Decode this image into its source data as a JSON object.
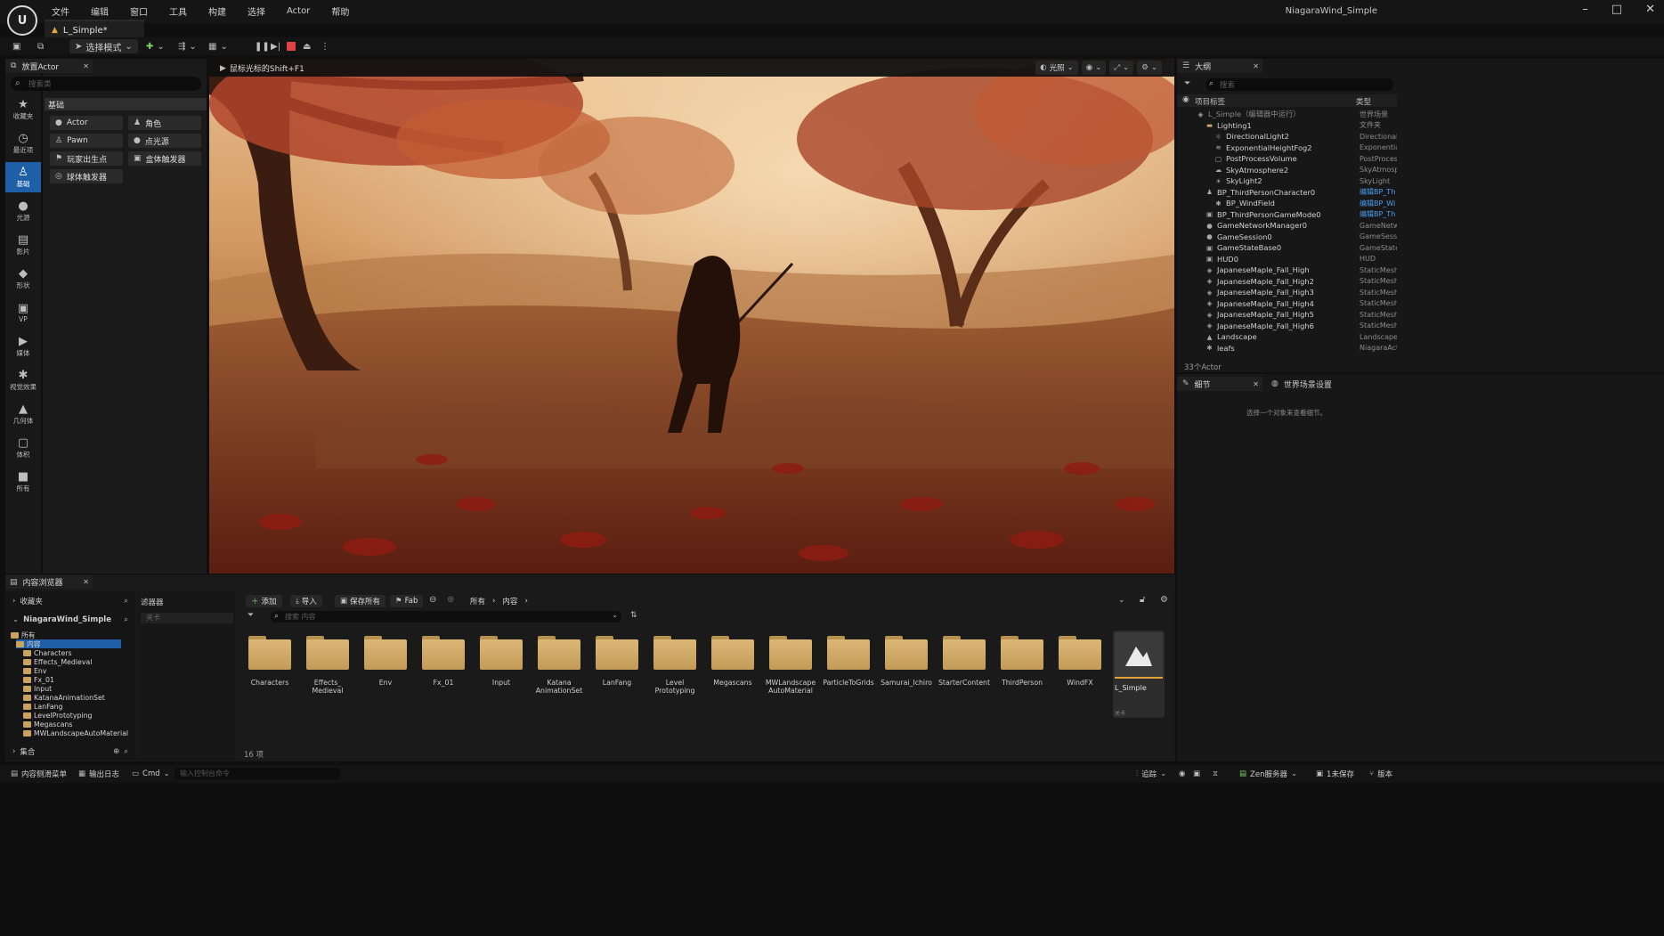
{
  "window": {
    "project_name": "NiagaraWind_Simple",
    "level_tab": "L_Simple*",
    "controls": {
      "minimize": "–",
      "maximize": "□",
      "close": "✕"
    }
  },
  "menu": [
    "文件",
    "编辑",
    "窗口",
    "工具",
    "构建",
    "选择",
    "Actor",
    "帮助"
  ],
  "toolbar": {
    "mode_label": "选择模式"
  },
  "toolstrip": [
    {
      "icon": "star-icon",
      "glyph": "★",
      "label": "收藏夹"
    },
    {
      "icon": "clock-icon",
      "glyph": "◷",
      "label": "最近项"
    },
    {
      "icon": "person-icon",
      "glyph": "♙",
      "label": "基础",
      "active": true
    },
    {
      "icon": "light-icon",
      "glyph": "●",
      "label": "光源"
    },
    {
      "icon": "film-icon",
      "glyph": "▤",
      "label": "影片"
    },
    {
      "icon": "shape-icon",
      "glyph": "◆",
      "label": "形状"
    },
    {
      "icon": "vp-icon",
      "glyph": "▣",
      "label": "VP"
    },
    {
      "icon": "media-icon",
      "glyph": "▶",
      "label": "媒体"
    },
    {
      "icon": "effects-icon",
      "glyph": "✱",
      "label": "视觉效果"
    },
    {
      "icon": "geometry-icon",
      "glyph": "▲",
      "label": "几何体"
    },
    {
      "icon": "volume-icon",
      "glyph": "▢",
      "label": "体积"
    },
    {
      "icon": "all-icon",
      "glyph": "■",
      "label": "所有"
    }
  ],
  "place_actors": {
    "tab_label": "放置Actor",
    "search_placeholder": "搜索类",
    "section": "基础",
    "items": [
      {
        "icon": "actor-icon",
        "glyph": "●",
        "label": "Actor"
      },
      {
        "icon": "character-icon",
        "glyph": "♟",
        "label": "角色"
      },
      {
        "icon": "pawn-icon",
        "glyph": "♙",
        "label": "Pawn"
      },
      {
        "icon": "pointlight-icon",
        "glyph": "●",
        "label": "点光源"
      },
      {
        "icon": "playerstart-icon",
        "glyph": "⚑",
        "label": "玩家出生点"
      },
      {
        "icon": "boxtrigger-icon",
        "glyph": "▣",
        "label": "盒体触发器"
      },
      {
        "icon": "spheretrigger-icon",
        "glyph": "◎",
        "label": "球体触发器"
      }
    ]
  },
  "viewport": {
    "hint": "鼠标光标的Shift+F1",
    "lighting_label": "光照"
  },
  "outliner": {
    "tab_label": "大纲",
    "search_placeholder": "搜索",
    "col_label": "项目标签",
    "col_type": "类型",
    "actor_count": "33个Actor",
    "rows": [
      {
        "indent": 0,
        "label": "L_Simple（编辑器中运行）",
        "type": "世界场景",
        "icon": "world-icon",
        "glyph": "◈",
        "dim": true
      },
      {
        "indent": 1,
        "label": "Lighting1",
        "type": "文件夹",
        "icon": "folder-icon",
        "glyph": "▬"
      },
      {
        "indent": 2,
        "label": "DirectionalLight2",
        "type": "Directional",
        "icon": "sun-icon",
        "glyph": "☼"
      },
      {
        "indent": 2,
        "label": "ExponentialHeightFog2",
        "type": "Exponential",
        "icon": "fog-icon",
        "glyph": "≋"
      },
      {
        "indent": 2,
        "label": "PostProcessVolume",
        "type": "PostProces",
        "icon": "volume-icon",
        "glyph": "▢"
      },
      {
        "indent": 2,
        "label": "SkyAtmosphere2",
        "type": "SkyAtmosp",
        "icon": "atmosphere-icon",
        "glyph": "☁"
      },
      {
        "indent": 2,
        "label": "SkyLight2",
        "type": "SkyLight",
        "icon": "skylight-icon",
        "glyph": "☀"
      },
      {
        "indent": 1,
        "label": "BP_ThirdPersonCharacter0",
        "type": "编辑BP_Th",
        "icon": "character-icon",
        "glyph": "♟",
        "link": true
      },
      {
        "indent": 2,
        "label": "BP_WindField",
        "type": "编辑BP_Wi",
        "icon": "actor-icon",
        "glyph": "✱",
        "link": true
      },
      {
        "indent": 1,
        "label": "BP_ThirdPersonGameMode0",
        "type": "编辑BP_Th",
        "icon": "gamemode-icon",
        "glyph": "▣",
        "link": true
      },
      {
        "indent": 1,
        "label": "GameNetworkManager0",
        "type": "GameNetw",
        "icon": "actor-icon",
        "glyph": "●"
      },
      {
        "indent": 1,
        "label": "GameSession0",
        "type": "GameSess",
        "icon": "actor-icon",
        "glyph": "●"
      },
      {
        "indent": 1,
        "label": "GameStateBase0",
        "type": "GameState",
        "icon": "actor-icon",
        "glyph": "▣"
      },
      {
        "indent": 1,
        "label": "HUD0",
        "type": "HUD",
        "icon": "hud-icon",
        "glyph": "▣"
      },
      {
        "indent": 1,
        "label": "JapaneseMaple_Fall_High",
        "type": "StaticMesh",
        "icon": "mesh-icon",
        "glyph": "◈"
      },
      {
        "indent": 1,
        "label": "JapaneseMaple_Fall_High2",
        "type": "StaticMesh",
        "icon": "mesh-icon",
        "glyph": "◈"
      },
      {
        "indent": 1,
        "label": "JapaneseMaple_Fall_High3",
        "type": "StaticMesh",
        "icon": "mesh-icon",
        "glyph": "◈"
      },
      {
        "indent": 1,
        "label": "JapaneseMaple_Fall_High4",
        "type": "StaticMesh",
        "icon": "mesh-icon",
        "glyph": "◈"
      },
      {
        "indent": 1,
        "label": "JapaneseMaple_Fall_High5",
        "type": "StaticMesh",
        "icon": "mesh-icon",
        "glyph": "◈"
      },
      {
        "indent": 1,
        "label": "JapaneseMaple_Fall_High6",
        "type": "StaticMesh",
        "icon": "mesh-icon",
        "glyph": "◈"
      },
      {
        "indent": 1,
        "label": "Landscape",
        "type": "Landscape",
        "icon": "landscape-icon",
        "glyph": "▲"
      },
      {
        "indent": 1,
        "label": "leafs",
        "type": "NiagaraAct",
        "icon": "niagara-icon",
        "glyph": "✱"
      }
    ]
  },
  "details": {
    "tab_label": "细节",
    "world_tab": "世界场景设置",
    "empty_hint": "选择一个对象来查看细节。"
  },
  "content_browser": {
    "tab_label": "内容浏览器",
    "favorites": "收藏夹",
    "project": "NiagaraWind_Simple",
    "filters_label": "滤器器",
    "filter_search": "关卡",
    "tree": [
      "所有",
      "内容",
      "Characters",
      "Effects_Medieval",
      "Env",
      "Fx_01",
      "Input",
      "KatanaAnimationSet",
      "LanFang",
      "LevelPrototyping",
      "Megascans",
      "MWLandscapeAutoMaterial"
    ],
    "collections": "集合",
    "buttons": {
      "add": "添加",
      "import": "导入",
      "save_all": "保存所有",
      "fab": "Fab"
    },
    "breadcrumb": [
      "所有",
      "内容"
    ],
    "search_placeholder": "搜索 内容",
    "items": [
      "Characters",
      "Effects_\nMedieval",
      "Env",
      "Fx_01",
      "Input",
      "Katana\nAnimationSet",
      "LanFang",
      "Level\nPrototyping",
      "Megascans",
      "MWLandscape\nAutoMaterial",
      "ParticleToGrids",
      "Samurai_Ichiro",
      "StarterContent",
      "ThirdPerson",
      "WindFX"
    ],
    "level_item": "L_Simple",
    "level_sub": "关卡",
    "item_count": "16 项"
  },
  "statusbar": {
    "drawer": "内容侧滑菜单",
    "output_log": "输出日志",
    "cmd": "Cmd",
    "cmd_placeholder": "输入控制台命令",
    "trace": "追踪",
    "zen": "Zen服务器",
    "unsaved": "1未保存",
    "version": "版本"
  },
  "colors": {
    "accent": "#1e5fa8",
    "link": "#4b9ff3",
    "folder": "#d1ab69",
    "stop": "#e04343"
  }
}
